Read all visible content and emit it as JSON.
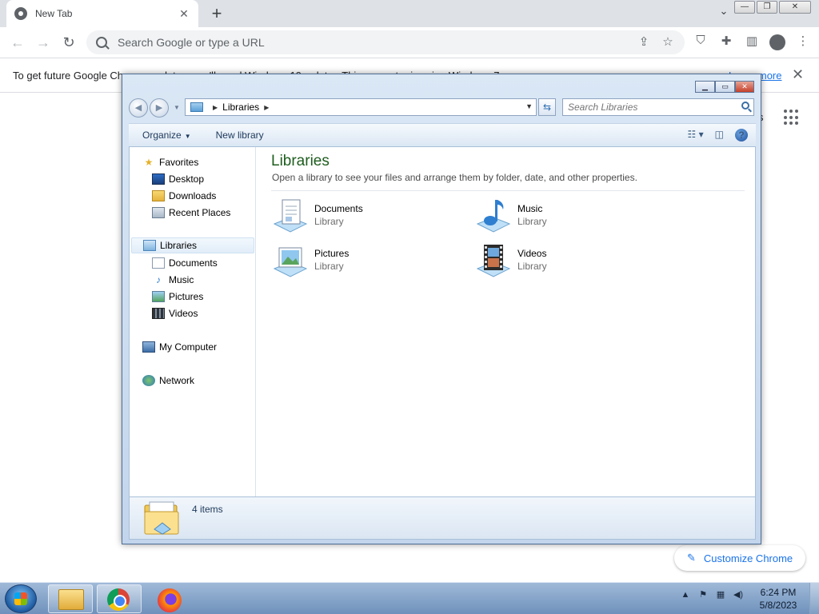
{
  "chrome": {
    "tab_title": "New Tab",
    "tab_close": "✕",
    "new_tab": "+",
    "tab_search": "⌄",
    "window_controls": {
      "minimize": "—",
      "restore": "❐",
      "close": "✕"
    },
    "omnibox_placeholder": "Search Google or type a URL",
    "infobar_text": "To get future Google Chrome updates, you'll need Windows 10 or later. This computer is using Windows 7.",
    "infobar_link": "Learn more",
    "infobar_close": "✕",
    "ntp_fragment": "s",
    "customize_label": "Customize Chrome"
  },
  "explorer": {
    "breadcrumb": "Libraries",
    "search_placeholder": "Search Libraries",
    "toolbar": {
      "organize": "Organize",
      "new_library": "New library"
    },
    "nav": {
      "favorites": "Favorites",
      "desktop": "Desktop",
      "downloads": "Downloads",
      "recent_places": "Recent Places",
      "libraries": "Libraries",
      "documents": "Documents",
      "music": "Music",
      "pictures": "Pictures",
      "videos": "Videos",
      "my_computer": "My Computer",
      "network": "Network"
    },
    "content": {
      "title": "Libraries",
      "subtitle": "Open a library to see your files and arrange them by folder, date, and other properties.",
      "items": [
        {
          "name": "Documents",
          "type": "Library",
          "icon": "documents-library-icon"
        },
        {
          "name": "Music",
          "type": "Library",
          "icon": "music-library-icon"
        },
        {
          "name": "Pictures",
          "type": "Library",
          "icon": "pictures-library-icon"
        },
        {
          "name": "Videos",
          "type": "Library",
          "icon": "videos-library-icon"
        }
      ]
    },
    "details_text": "4 items"
  },
  "taskbar": {
    "apps": [
      "windows-explorer",
      "google-chrome",
      "firefox"
    ],
    "clock_time": "6:24 PM",
    "clock_date": "5/8/2023"
  },
  "colors": {
    "chrome_tabstrip": "#dee1e6",
    "chrome_link": "#1a73e8",
    "explorer_title": "#1e5d1e",
    "taskbar": "#7f9ec6"
  }
}
